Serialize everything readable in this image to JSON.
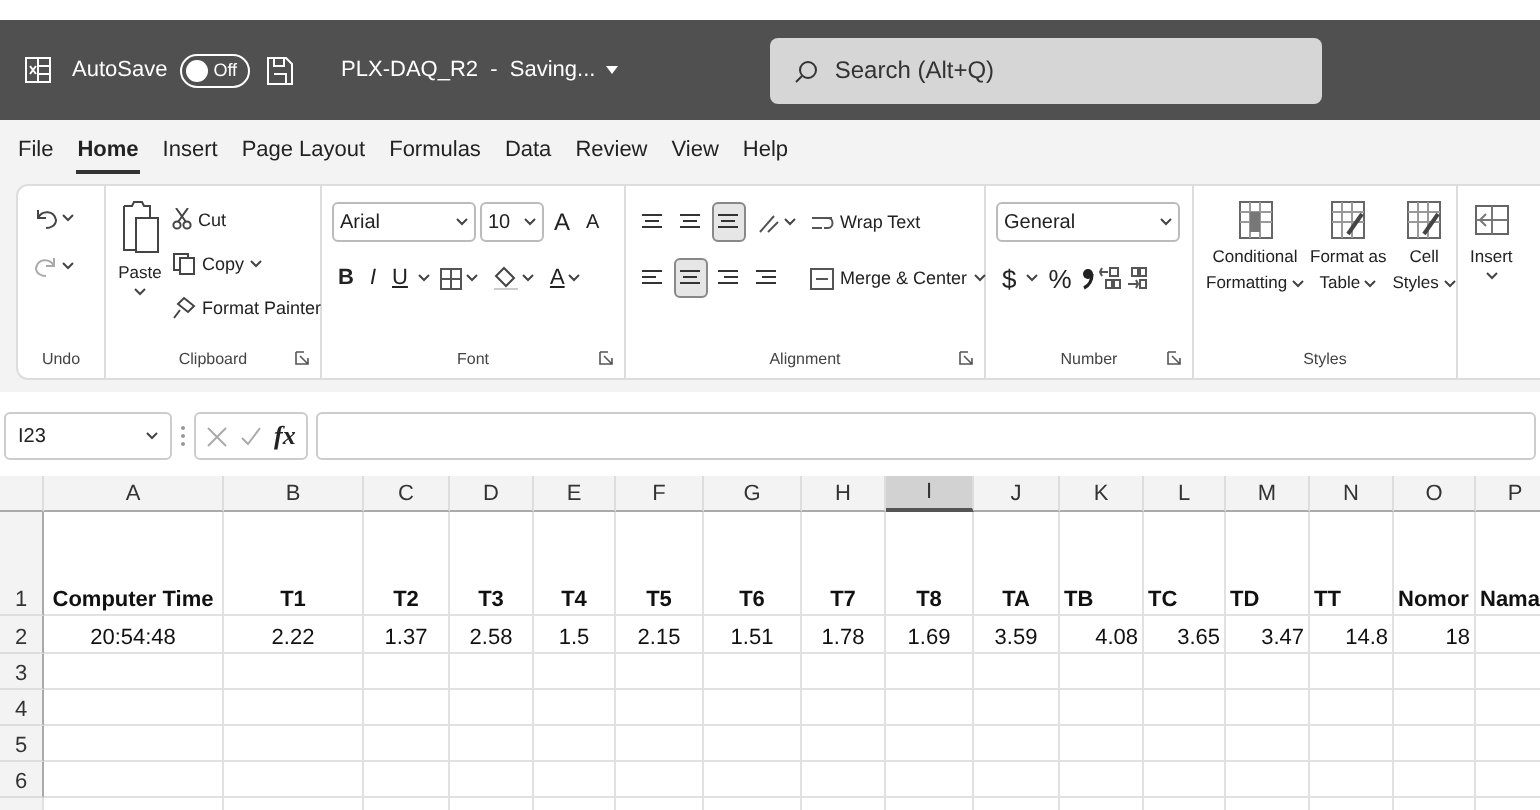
{
  "title_bar": {
    "autosave_label": "AutoSave",
    "autosave_on": false,
    "toggle_text": "Off",
    "document_title": "PLX-DAQ_R2  -  Saving...",
    "search_placeholder": "Search (Alt+Q)"
  },
  "menu_tabs": [
    {
      "label": "File",
      "selected": false
    },
    {
      "label": "Home",
      "selected": true
    },
    {
      "label": "Insert",
      "selected": false
    },
    {
      "label": "Page Layout",
      "selected": false
    },
    {
      "label": "Formulas",
      "selected": false
    },
    {
      "label": "Data",
      "selected": false
    },
    {
      "label": "Review",
      "selected": false
    },
    {
      "label": "View",
      "selected": false
    },
    {
      "label": "Help",
      "selected": false
    }
  ],
  "ribbon": {
    "undo": {
      "label": "Undo"
    },
    "clipboard": {
      "label": "Clipboard",
      "paste": "Paste",
      "cut": "Cut",
      "copy": "Copy",
      "format_painter": "Format Painter"
    },
    "font": {
      "label": "Font",
      "font_name": "Arial",
      "font_size": "10",
      "grow": "A",
      "shrink": "A",
      "bold": "B",
      "italic": "I",
      "underline": "U",
      "font_color": "A"
    },
    "alignment": {
      "label": "Alignment",
      "vertical_align": [
        {
          "selected": false
        },
        {
          "selected": false
        },
        {
          "selected": true
        }
      ],
      "horizontal_align": [
        {
          "selected": false
        },
        {
          "selected": true
        },
        {
          "selected": false
        }
      ],
      "wrap_text": "Wrap Text",
      "merge": "Merge & Center"
    },
    "number": {
      "label": "Number",
      "format": "General",
      "currency": "$",
      "percent": "%"
    },
    "styles": {
      "label": "Styles",
      "buttons": [
        {
          "lines": [
            "Conditional",
            "Formatting"
          ]
        },
        {
          "lines": [
            "Format as",
            "Table"
          ]
        },
        {
          "lines": [
            "Cell",
            "Styles"
          ]
        }
      ]
    },
    "cells": {
      "insert": "Insert"
    }
  },
  "formula_bar": {
    "name_box": "I23",
    "function_label": "fx"
  },
  "sheet": {
    "columns": [
      {
        "letter": "A",
        "selected": false
      },
      {
        "letter": "B",
        "selected": false
      },
      {
        "letter": "C",
        "selected": false
      },
      {
        "letter": "D",
        "selected": false
      },
      {
        "letter": "E",
        "selected": false
      },
      {
        "letter": "F",
        "selected": false
      },
      {
        "letter": "G",
        "selected": false
      },
      {
        "letter": "H",
        "selected": false
      },
      {
        "letter": "I",
        "selected": true
      },
      {
        "letter": "J",
        "selected": false
      },
      {
        "letter": "K",
        "selected": false
      },
      {
        "letter": "L",
        "selected": false
      },
      {
        "letter": "M",
        "selected": false
      },
      {
        "letter": "N",
        "selected": false
      },
      {
        "letter": "O",
        "selected": false
      },
      {
        "letter": "P",
        "selected": false
      }
    ],
    "rows": [
      {
        "number": "1",
        "kind": "header",
        "cells": [
          {
            "text": "Computer Time",
            "kind": "center"
          },
          {
            "text": "T1",
            "kind": "center"
          },
          {
            "text": "T2",
            "kind": "center"
          },
          {
            "text": "T3",
            "kind": "center"
          },
          {
            "text": "T4",
            "kind": "center"
          },
          {
            "text": "T5",
            "kind": "center"
          },
          {
            "text": "T6",
            "kind": "center"
          },
          {
            "text": "T7",
            "kind": "center"
          },
          {
            "text": "T8",
            "kind": "center"
          },
          {
            "text": "TA",
            "kind": "center"
          },
          {
            "text": "TB",
            "kind": "left"
          },
          {
            "text": "TC",
            "kind": "left"
          },
          {
            "text": "TD",
            "kind": "left"
          },
          {
            "text": "TT",
            "kind": "left"
          },
          {
            "text": "Nomor",
            "kind": "left"
          },
          {
            "text": "Nama",
            "kind": "left"
          }
        ]
      },
      {
        "number": "2",
        "kind": "data",
        "cells": [
          {
            "text": "20:54:48",
            "kind": "center"
          },
          {
            "text": "2.22",
            "kind": "center"
          },
          {
            "text": "1.37",
            "kind": "center"
          },
          {
            "text": "2.58",
            "kind": "center"
          },
          {
            "text": "1.5",
            "kind": "center"
          },
          {
            "text": "2.15",
            "kind": "center"
          },
          {
            "text": "1.51",
            "kind": "center"
          },
          {
            "text": "1.78",
            "kind": "center"
          },
          {
            "text": "1.69",
            "kind": "center"
          },
          {
            "text": "3.59",
            "kind": "center"
          },
          {
            "text": "4.08",
            "kind": "right"
          },
          {
            "text": "3.65",
            "kind": "right"
          },
          {
            "text": "3.47",
            "kind": "right"
          },
          {
            "text": "14.8",
            "kind": "right"
          },
          {
            "text": "18",
            "kind": "right"
          }
        ]
      },
      {
        "number": "3",
        "kind": "data"
      },
      {
        "number": "4",
        "kind": "data"
      },
      {
        "number": "5",
        "kind": "data"
      },
      {
        "number": "6",
        "kind": "data"
      }
    ]
  }
}
